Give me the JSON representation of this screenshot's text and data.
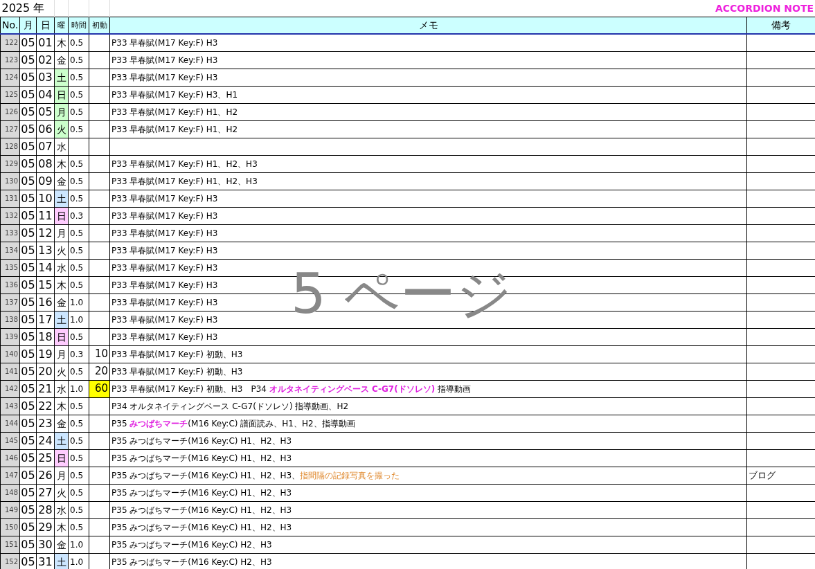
{
  "sheet": {
    "year": "2025 年",
    "title": "ACCORDION NOTE",
    "page_label": "5 ページ"
  },
  "columns": [
    "No.",
    "月",
    "日",
    "曜",
    "時間",
    "初動",
    "メモ",
    "備考"
  ],
  "rows": [
    {
      "no": "122",
      "month": "05",
      "day": "01",
      "weekday": "木",
      "color": "#ffffff",
      "hours": "0.5",
      "first": "",
      "highlighted": false,
      "memo": "P33 早春賦(M17 Key:F) H3",
      "note": ""
    },
    {
      "no": "123",
      "month": "05",
      "day": "02",
      "weekday": "金",
      "color": "#ffffff",
      "hours": "0.5",
      "first": "",
      "highlighted": false,
      "memo": "P33 早春賦(M17 Key:F) H3",
      "note": ""
    },
    {
      "no": "124",
      "month": "05",
      "day": "03",
      "weekday": "土",
      "color": "#ccffcc",
      "hours": "0.5",
      "first": "",
      "highlighted": false,
      "memo": "P33 早春賦(M17 Key:F) H3",
      "note": ""
    },
    {
      "no": "125",
      "month": "05",
      "day": "04",
      "weekday": "日",
      "color": "#ccffcc",
      "hours": "0.5",
      "first": "",
      "highlighted": false,
      "memo": "P33 早春賦(M17 Key:F) H3、H1",
      "note": ""
    },
    {
      "no": "126",
      "month": "05",
      "day": "05",
      "weekday": "月",
      "color": "#ccffcc",
      "hours": "0.5",
      "first": "",
      "highlighted": false,
      "memo": "P33 早春賦(M17 Key:F) H1、H2",
      "note": ""
    },
    {
      "no": "127",
      "month": "05",
      "day": "06",
      "weekday": "火",
      "color": "#ccffcc",
      "hours": "0.5",
      "first": "",
      "highlighted": false,
      "memo": "P33 早春賦(M17 Key:F) H1、H2",
      "note": ""
    },
    {
      "no": "128",
      "month": "05",
      "day": "07",
      "weekday": "水",
      "color": "#ffffff",
      "hours": "",
      "first": "",
      "highlighted": false,
      "memo": "",
      "note": ""
    },
    {
      "no": "129",
      "month": "05",
      "day": "08",
      "weekday": "木",
      "color": "#ffffff",
      "hours": "0.5",
      "first": "",
      "highlighted": false,
      "memo": "P33 早春賦(M17 Key:F) H1、H2、H3",
      "note": ""
    },
    {
      "no": "130",
      "month": "05",
      "day": "09",
      "weekday": "金",
      "color": "#ffffff",
      "hours": "0.5",
      "first": "",
      "highlighted": false,
      "memo": "P33 早春賦(M17 Key:F) H1、H2、H3",
      "note": ""
    },
    {
      "no": "131",
      "month": "05",
      "day": "10",
      "weekday": "土",
      "color": "#cce6ff",
      "hours": "0.5",
      "first": "",
      "highlighted": false,
      "memo": "P33 早春賦(M17 Key:F) H3",
      "note": ""
    },
    {
      "no": "132",
      "month": "05",
      "day": "11",
      "weekday": "日",
      "color": "#ffccff",
      "hours": "0.3",
      "first": "",
      "highlighted": false,
      "memo": "P33 早春賦(M17 Key:F) H3",
      "note": ""
    },
    {
      "no": "133",
      "month": "05",
      "day": "12",
      "weekday": "月",
      "color": "#ffffff",
      "hours": "0.5",
      "first": "",
      "highlighted": false,
      "memo": "P33 早春賦(M17 Key:F) H3",
      "note": ""
    },
    {
      "no": "134",
      "month": "05",
      "day": "13",
      "weekday": "火",
      "color": "#ffffff",
      "hours": "0.5",
      "first": "",
      "highlighted": false,
      "memo": "P33 早春賦(M17 Key:F) H3",
      "note": ""
    },
    {
      "no": "135",
      "month": "05",
      "day": "14",
      "weekday": "水",
      "color": "#ffffff",
      "hours": "0.5",
      "first": "",
      "highlighted": false,
      "memo": "P33 早春賦(M17 Key:F) H3",
      "note": ""
    },
    {
      "no": "136",
      "month": "05",
      "day": "15",
      "weekday": "木",
      "color": "#ffffff",
      "hours": "0.5",
      "first": "",
      "highlighted": false,
      "memo": "P33 早春賦(M17 Key:F) H3",
      "note": ""
    },
    {
      "no": "137",
      "month": "05",
      "day": "16",
      "weekday": "金",
      "color": "#ffffff",
      "hours": "1.0",
      "first": "",
      "highlighted": false,
      "memo": "P33 早春賦(M17 Key:F) H3",
      "note": ""
    },
    {
      "no": "138",
      "month": "05",
      "day": "17",
      "weekday": "土",
      "color": "#cce6ff",
      "hours": "1.0",
      "first": "",
      "highlighted": false,
      "memo": "P33 早春賦(M17 Key:F) H3",
      "note": ""
    },
    {
      "no": "139",
      "month": "05",
      "day": "18",
      "weekday": "日",
      "color": "#ffccff",
      "hours": "0.5",
      "first": "",
      "highlighted": false,
      "memo": "P33 早春賦(M17 Key:F) H3",
      "note": ""
    },
    {
      "no": "140",
      "month": "05",
      "day": "19",
      "weekday": "月",
      "color": "#ffffff",
      "hours": "0.3",
      "first": "10",
      "highlighted": false,
      "memo": "P33 早春賦(M17 Key:F) 初動、H3",
      "note": ""
    },
    {
      "no": "141",
      "month": "05",
      "day": "20",
      "weekday": "火",
      "color": "#ffffff",
      "hours": "0.5",
      "first": "20",
      "highlighted": false,
      "memo": "P33 早春賦(M17 Key:F) 初動、H3",
      "note": ""
    },
    {
      "no": "142",
      "month": "05",
      "day": "21",
      "weekday": "水",
      "color": "#ffffff",
      "hours": "1.0",
      "first": "60",
      "highlighted": true,
      "memo": [
        {
          "kind": "plain",
          "text": "P33 早春賦(M17 Key:F) 初動、H3　P34 "
        },
        {
          "kind": "title",
          "text": "オルタネイティングベース C-G7(ドソレソ)"
        },
        {
          "kind": "plain",
          "text": " 指導動画"
        }
      ],
      "note": ""
    },
    {
      "no": "143",
      "month": "05",
      "day": "22",
      "weekday": "木",
      "color": "#ffffff",
      "hours": "0.5",
      "first": "",
      "highlighted": false,
      "memo": "P34 オルタネイティングベース C-G7(ドソレソ) 指導動画、H2",
      "note": ""
    },
    {
      "no": "144",
      "month": "05",
      "day": "23",
      "weekday": "金",
      "color": "#ffffff",
      "hours": "0.5",
      "first": "",
      "highlighted": false,
      "memo": [
        {
          "kind": "plain",
          "text": "P35 "
        },
        {
          "kind": "title",
          "text": "みつばちマーチ"
        },
        {
          "kind": "plain",
          "text": "(M16 Key:C) 譜面読み、H1、H2、指導動画"
        }
      ],
      "note": ""
    },
    {
      "no": "145",
      "month": "05",
      "day": "24",
      "weekday": "土",
      "color": "#cce6ff",
      "hours": "0.5",
      "first": "",
      "highlighted": false,
      "memo": "P35 みつばちマーチ(M16 Key:C) H1、H2、H3",
      "note": ""
    },
    {
      "no": "146",
      "month": "05",
      "day": "25",
      "weekday": "日",
      "color": "#ffccff",
      "hours": "0.5",
      "first": "",
      "highlighted": false,
      "memo": "P35 みつばちマーチ(M16 Key:C) H1、H2、H3",
      "note": ""
    },
    {
      "no": "147",
      "month": "05",
      "day": "26",
      "weekday": "月",
      "color": "#ffffff",
      "hours": "0.5",
      "first": "",
      "highlighted": false,
      "memo": [
        {
          "kind": "plain",
          "text": "P35 みつばちマーチ(M16 Key:C) H1、H2、H3、"
        },
        {
          "kind": "remark",
          "text": "指間隔の記録写真を撮った"
        }
      ],
      "note": "ブログ"
    },
    {
      "no": "148",
      "month": "05",
      "day": "27",
      "weekday": "火",
      "color": "#ffffff",
      "hours": "0.5",
      "first": "",
      "highlighted": false,
      "memo": "P35 みつばちマーチ(M16 Key:C) H1、H2、H3",
      "note": ""
    },
    {
      "no": "149",
      "month": "05",
      "day": "28",
      "weekday": "水",
      "color": "#ffffff",
      "hours": "0.5",
      "first": "",
      "highlighted": false,
      "memo": "P35 みつばちマーチ(M16 Key:C) H1、H2、H3",
      "note": ""
    },
    {
      "no": "150",
      "month": "05",
      "day": "29",
      "weekday": "木",
      "color": "#ffffff",
      "hours": "0.5",
      "first": "",
      "highlighted": false,
      "memo": "P35 みつばちマーチ(M16 Key:C) H1、H2、H3",
      "note": ""
    },
    {
      "no": "151",
      "month": "05",
      "day": "30",
      "weekday": "金",
      "color": "#ffffff",
      "hours": "1.0",
      "first": "",
      "highlighted": false,
      "memo": "P35 みつばちマーチ(M16 Key:C) H2、H3",
      "note": ""
    },
    {
      "no": "152",
      "month": "05",
      "day": "31",
      "weekday": "土",
      "color": "#cce6ff",
      "hours": "1.0",
      "first": "",
      "highlighted": false,
      "memo": "P35 みつばちマーチ(M16 Key:C) H2、H3",
      "note": ""
    }
  ]
}
